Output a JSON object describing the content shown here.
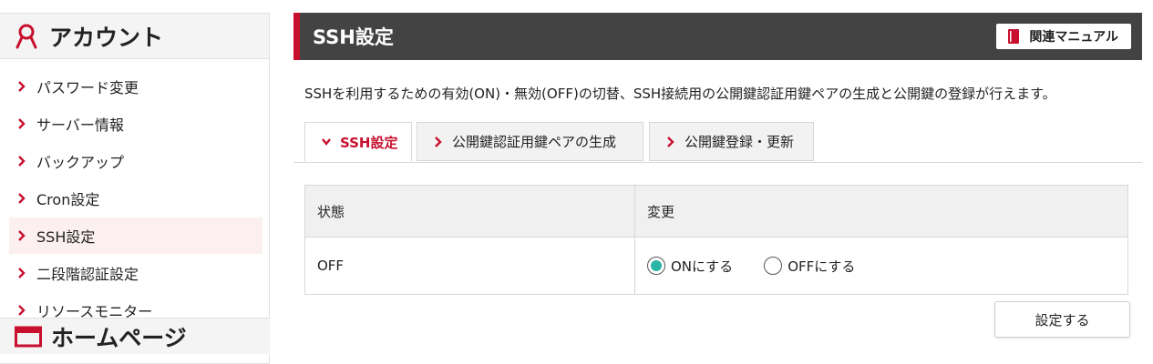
{
  "sidebar": {
    "account_title": "アカウント",
    "items": [
      {
        "label": "パスワード変更"
      },
      {
        "label": "サーバー情報"
      },
      {
        "label": "バックアップ"
      },
      {
        "label": "Cron設定"
      },
      {
        "label": "SSH設定",
        "active": true
      },
      {
        "label": "二段階認証設定"
      },
      {
        "label": "リソースモニター"
      }
    ],
    "homepage_title": "ホームページ"
  },
  "header": {
    "title": "SSH設定",
    "manual_label": "関連マニュアル"
  },
  "description": "SSHを利用するための有効(ON)・無効(OFF)の切替、SSH接続用の公開鍵認証用鍵ペアの生成と公開鍵の登録が行えます。",
  "tabs": [
    {
      "label": "SSH設定",
      "active": true
    },
    {
      "label": "公開鍵認証用鍵ペアの生成"
    },
    {
      "label": "公開鍵登録・更新"
    }
  ],
  "table": {
    "headers": [
      "状態",
      "変更"
    ],
    "status_value": "OFF",
    "radio_on_label": "ONにする",
    "radio_off_label": "OFFにする",
    "selected": "ON"
  },
  "submit_label": "設定する",
  "colors": {
    "accent": "#c8102e",
    "header_bg": "#434343",
    "radio_selected": "#2bb5a6"
  }
}
